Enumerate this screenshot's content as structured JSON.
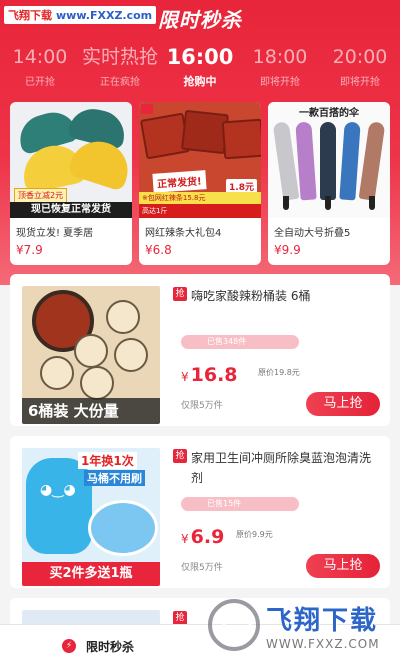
{
  "watermark_top": {
    "site_name": "飞翔下载",
    "url": "www.FXXZ.com"
  },
  "header": {
    "title": "限时秒杀"
  },
  "time_slots": [
    {
      "time": "14:00",
      "state": "已开抢"
    },
    {
      "time": "实时热抢",
      "state": "正在疯抢"
    },
    {
      "time": "16:00",
      "state": "抢购中"
    },
    {
      "time": "18:00",
      "state": "即将开抢"
    },
    {
      "time": "20:00",
      "state": "即将开抢"
    }
  ],
  "active_slot_index": 2,
  "top_products": [
    {
      "name": "现货立发! 夏季居",
      "price": "¥7.9",
      "image_texts": {
        "tag": "顶香立减2元",
        "banner": "现已恢复正常发货"
      }
    },
    {
      "name": "网红辣条大礼包4",
      "price": "¥6.8",
      "image_texts": {
        "label": "正常发货!",
        "ribbon": "※包网红辣条15.8元",
        "ribbon2": "高达1斤",
        "price_tag": "1.8元"
      }
    },
    {
      "name": "全自动大号折叠5",
      "price": "¥9.9",
      "image_texts": {
        "title": "一款百搭的伞"
      }
    }
  ],
  "items": [
    {
      "tag": "抢",
      "title": "嗨吃家酸辣粉桶装 6桶",
      "sold": "已售348件",
      "currency": "¥",
      "price": "16.8",
      "original_price": "原价19.8元",
      "limit": "仅限5万件",
      "buy_label": "马上抢",
      "image_text": "6桶装 大份量"
    },
    {
      "tag": "抢",
      "title": "家用卫生间冲厕所除臭蓝泡泡清洗剂",
      "sold": "已售15件",
      "currency": "¥",
      "price": "6.9",
      "original_price": "原价9.9元",
      "limit": "仅限5万件",
      "buy_label": "马上抢",
      "image_texts": {
        "top1": "1年换1次",
        "top2": "马桶不用刷",
        "bottom": "买2件多送1瓶"
      }
    },
    {
      "tag": "抢"
    }
  ],
  "bottom_nav": {
    "seckill_label": "限时秒杀"
  },
  "watermark_bottom": {
    "name": "飞翔下载",
    "url": "WWW.FXXZ.COM"
  },
  "colors": {
    "primary": "#e8253a",
    "sold_bar": "#f7bfc5"
  }
}
